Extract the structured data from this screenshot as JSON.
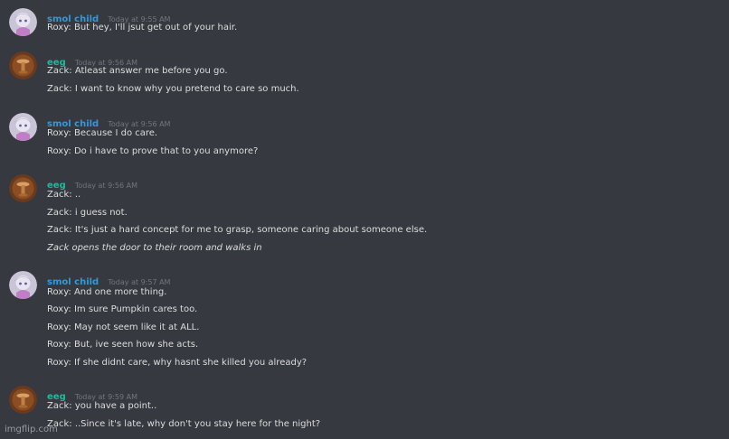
{
  "groups": [
    {
      "username": "smol child",
      "timestamp": "Today at 9:55 AM",
      "lines": [
        "Roxy: But hey, I'll jsut get out of your hair."
      ]
    },
    {
      "username": "eeg",
      "timestamp": "Today at 9:56 AM",
      "lines": [
        "Zack: Atleast answer me before you go.",
        "Zack: I want to know why you pretend to care so much."
      ]
    },
    {
      "username": "smol child",
      "timestamp": "Today at 9:56 AM",
      "lines": [
        "Roxy: Because I do care.",
        "Roxy: Do i have to prove that to you anymore?"
      ]
    },
    {
      "username": "eeg",
      "timestamp": "Today at 9:56 AM",
      "lines": [
        "Zack: ..",
        "Zack: i guess not.",
        "Zack: It's just a hard concept for me to grasp, someone caring about someone else.",
        "Zack opens the door to their room and walks in"
      ]
    },
    {
      "username": "smol child",
      "timestamp": "Today at 9:57 AM",
      "lines": [
        "Roxy: And one more thing.",
        "Roxy: Im sure Pumpkin cares too.",
        "Roxy: May not seem like it at ALL.",
        "Roxy: But, ive seen how she acts.",
        "Roxy: If she didnt care, why hasnt she killed you already?"
      ]
    },
    {
      "username": "eeg",
      "timestamp": "Today at 9:59 AM",
      "lines": [
        "Zack: you have a point..",
        "Zack: ..Since it's late, why don't you stay here for the night?"
      ]
    }
  ],
  "watermark": "imgflip.com",
  "colors": {
    "background": "#36393f",
    "smol_child_name": "#3498db",
    "eeg_name": "#1abc9c",
    "message_text": "#dcddde",
    "timestamp": "#72767d"
  }
}
